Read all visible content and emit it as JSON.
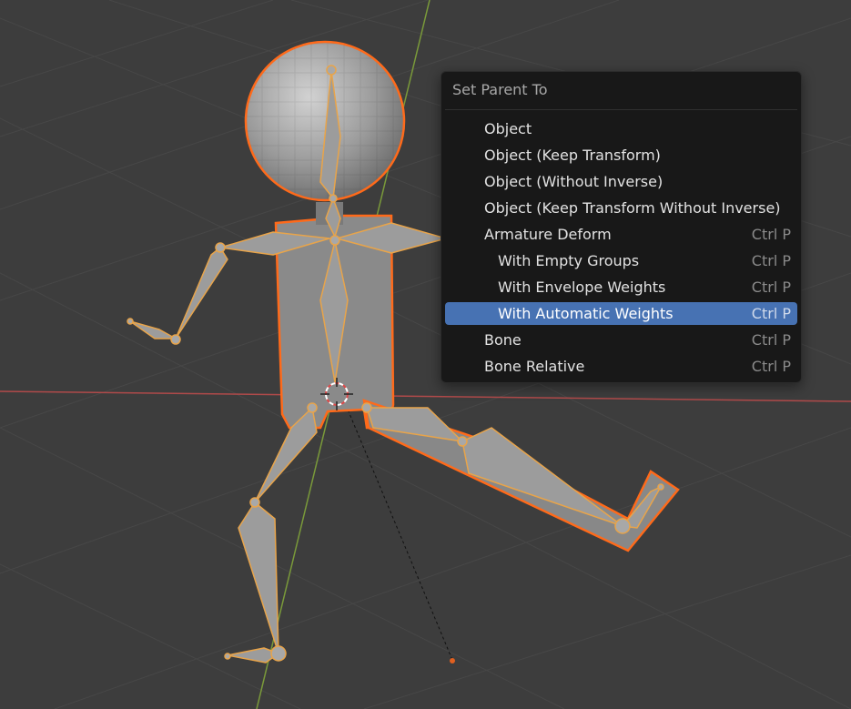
{
  "viewport": {
    "name": "3D Viewport",
    "background": "#3d3d3d",
    "x_axis_color": "#b04a4a",
    "y_axis_color": "#7a9a3a",
    "selection_outline": "#ff7a2a",
    "bone_color": "#e8a44a"
  },
  "menu": {
    "title": "Set Parent To",
    "highlight_color": "#4772b3",
    "items": [
      {
        "label": "Object",
        "shortcut": "",
        "sub": false,
        "active": false
      },
      {
        "label": "Object (Keep Transform)",
        "shortcut": "",
        "sub": false,
        "active": false
      },
      {
        "label": "Object (Without Inverse)",
        "shortcut": "",
        "sub": false,
        "active": false
      },
      {
        "label": "Object (Keep Transform Without Inverse)",
        "shortcut": "",
        "sub": false,
        "active": false
      },
      {
        "label": "Armature Deform",
        "shortcut": "Ctrl P",
        "sub": false,
        "active": false
      },
      {
        "label": "With Empty Groups",
        "shortcut": "Ctrl P",
        "sub": true,
        "active": false
      },
      {
        "label": "With Envelope Weights",
        "shortcut": "Ctrl P",
        "sub": true,
        "active": false
      },
      {
        "label": "With Automatic Weights",
        "shortcut": "Ctrl P",
        "sub": true,
        "active": true
      },
      {
        "label": "Bone",
        "shortcut": "Ctrl P",
        "sub": false,
        "active": false
      },
      {
        "label": "Bone Relative",
        "shortcut": "Ctrl P",
        "sub": false,
        "active": false
      }
    ]
  }
}
